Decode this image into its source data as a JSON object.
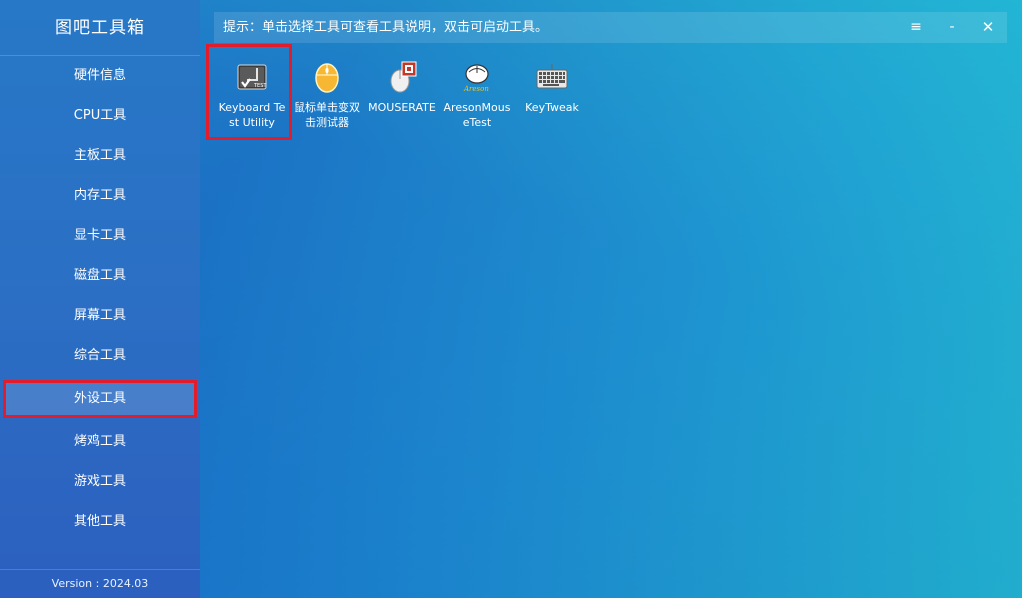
{
  "app": {
    "title": "图吧工具箱",
    "version": "Version : 2024.03"
  },
  "sidebar": {
    "items": [
      {
        "label": "硬件信息"
      },
      {
        "label": "CPU工具"
      },
      {
        "label": "主板工具"
      },
      {
        "label": "内存工具"
      },
      {
        "label": "显卡工具"
      },
      {
        "label": "磁盘工具"
      },
      {
        "label": "屏幕工具"
      },
      {
        "label": "综合工具"
      },
      {
        "label": "外设工具",
        "active": true
      },
      {
        "label": "烤鸡工具"
      },
      {
        "label": "游戏工具"
      },
      {
        "label": "其他工具"
      }
    ]
  },
  "topbar": {
    "hint": "提示：单击选择工具可查看工具说明，双击可启动工具。",
    "menu_icon": "≡",
    "minimize_icon": "-",
    "close_icon": "✕"
  },
  "tools": [
    {
      "label": "Keyboard Test Utility",
      "icon": "keyboard-test-icon",
      "selected": true
    },
    {
      "label": "鼠标单击变双击测试器",
      "icon": "mouse-icon"
    },
    {
      "label": "MOUSERATE",
      "icon": "mouserate-icon"
    },
    {
      "label": "AresonMouseTest",
      "icon": "areson-icon"
    },
    {
      "label": "KeyTweak",
      "icon": "keytweak-icon"
    }
  ],
  "colors": {
    "highlight": "#e21c2a",
    "text": "#ffffff"
  }
}
